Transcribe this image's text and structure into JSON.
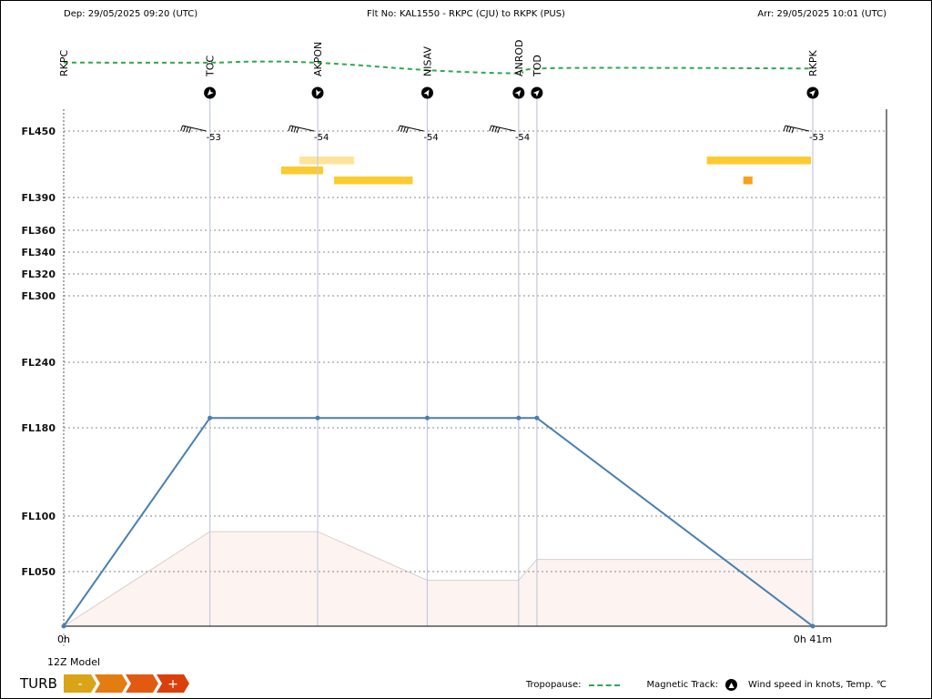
{
  "header": {
    "departure": "Dep: 29/05/2025 09:20 (UTC)",
    "flight": "Flt No: KAL1550 - RKPC (CJU) to RKPK (PUS)",
    "arrival": "Arr: 29/05/2025 10:01 (UTC)"
  },
  "chart_data": {
    "type": "line",
    "title": "Flt No: KAL1550 - RKPC (CJU) to RKPK (PUS)",
    "xlabel": "",
    "ylabel": "",
    "x_axis": {
      "type": "elapsed time",
      "range_min": [
        0,
        41
      ],
      "tick_labels": [
        "0h",
        "0h 41m"
      ]
    },
    "y_axis": {
      "unit": "flight level",
      "range": [
        0,
        460
      ],
      "tick_values": [
        50,
        100,
        180,
        240,
        300,
        320,
        340,
        360,
        390,
        450
      ],
      "tick_labels": [
        "FL050",
        "FL100",
        "FL180",
        "FL240",
        "FL300",
        "FL320",
        "FL340",
        "FL360",
        "FL390",
        "FL450"
      ],
      "grid": "dotted horizontal"
    },
    "waypoints": [
      {
        "name": "RKPC",
        "t": 0.0,
        "track_deg": null,
        "wind_barb": false,
        "temp": null
      },
      {
        "name": "TOC",
        "t": 8.0,
        "track_deg": 225,
        "wind_barb": true,
        "temp": "-53"
      },
      {
        "name": "AKPON",
        "t": 13.9,
        "track_deg": 200,
        "wind_barb": true,
        "temp": "-54"
      },
      {
        "name": "NISAV",
        "t": 19.9,
        "track_deg": 30,
        "wind_barb": true,
        "temp": "-54"
      },
      {
        "name": "ANROD",
        "t": 24.9,
        "track_deg": 40,
        "wind_barb": true,
        "temp": "-54"
      },
      {
        "name": "TOD",
        "t": 25.9,
        "track_deg": 45,
        "wind_barb": false,
        "temp": null
      },
      {
        "name": "RKPK",
        "t": 41.0,
        "track_deg": 45,
        "wind_barb": true,
        "temp": "-53"
      }
    ],
    "series": [
      {
        "name": "",
        "role": "flight profile",
        "color": "#4a7fad",
        "points": [
          [
            0.0,
            0
          ],
          [
            8.0,
            189
          ],
          [
            13.9,
            189
          ],
          [
            19.9,
            189
          ],
          [
            24.9,
            189
          ],
          [
            25.9,
            189
          ],
          [
            41.0,
            0
          ]
        ]
      },
      {
        "name": "",
        "role": "terrain",
        "color": "#fdf3f0",
        "points": [
          [
            0.0,
            0
          ],
          [
            8.0,
            86
          ],
          [
            13.9,
            86
          ],
          [
            19.9,
            42
          ],
          [
            24.9,
            42
          ],
          [
            25.9,
            61
          ],
          [
            41.0,
            61
          ]
        ]
      }
    ],
    "tropopause_pct": [
      [
        0.0,
        9
      ],
      [
        2.0,
        9.2
      ],
      [
        8.0,
        9.2
      ],
      [
        10.0,
        8.2
      ],
      [
        12.5,
        8.3
      ],
      [
        15.5,
        11.0
      ],
      [
        19.0,
        15.8
      ],
      [
        22.0,
        18.8
      ],
      [
        24.9,
        20.0
      ],
      [
        25.1,
        17.0
      ],
      [
        26.5,
        15.0
      ],
      [
        30.0,
        14.5
      ],
      [
        36.0,
        14.8
      ],
      [
        41.0,
        15.2
      ]
    ],
    "turbulence_areas": [
      {
        "t_start": 12.9,
        "t_end": 15.9,
        "fl_top": 427,
        "fl_bottom": 420,
        "severity": "light",
        "color": "#fde49a"
      },
      {
        "t_start": 11.9,
        "t_end": 14.2,
        "fl_top": 418,
        "fl_bottom": 411,
        "severity": "moderate",
        "color": "#fccb2f"
      },
      {
        "t_start": 14.8,
        "t_end": 19.1,
        "fl_top": 409,
        "fl_bottom": 402,
        "severity": "moderate",
        "color": "#fccb2f"
      },
      {
        "t_start": 35.2,
        "t_end": 40.9,
        "fl_top": 427,
        "fl_bottom": 420,
        "severity": "moderate",
        "color": "#fccb2f"
      },
      {
        "t_start": 37.2,
        "t_end": 37.7,
        "fl_top": 409,
        "fl_bottom": 402,
        "severity": "severe",
        "color": "#f7a21a"
      }
    ]
  },
  "footer": {
    "model": "12Z Model",
    "turb_label": "TURB",
    "turb_scale": [
      {
        "label": "-",
        "color": "#d9a417"
      },
      {
        "label": "",
        "color": "#e37d12"
      },
      {
        "label": "",
        "color": "#e25a10"
      },
      {
        "label": "+",
        "color": "#d9400c"
      }
    ]
  },
  "legend": {
    "tropopause": "Tropopause:",
    "magnetic_track": "Magnetic Track:",
    "wind": "Wind speed in knots, Temp. ℃"
  },
  "colors": {
    "grid": "#888888",
    "waypoint_line": "#c5c9dc",
    "tropopause": "#2fa84f"
  }
}
